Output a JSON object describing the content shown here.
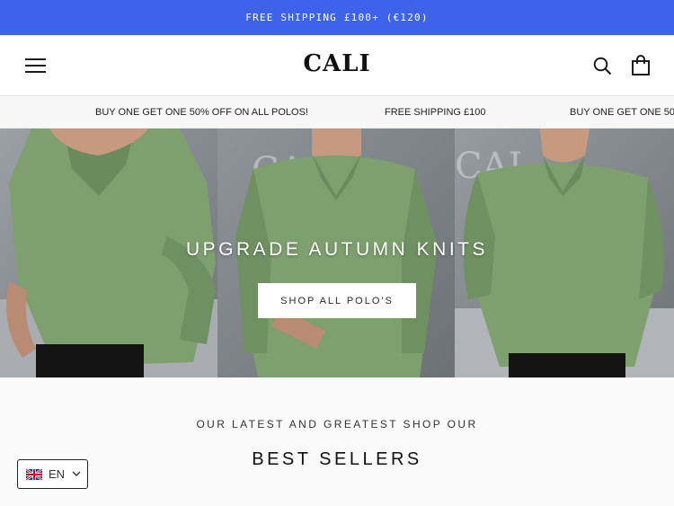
{
  "announcement": {
    "text": "FREE SHIPPING £100+ (€120)"
  },
  "header": {
    "logo": "CALI",
    "icons": [
      "menu-icon",
      "search-icon",
      "shopping-bag-icon"
    ]
  },
  "marquee": {
    "items": [
      "BUY ONE GET ONE 50% OFF ON ALL POLOS!",
      "FREE SHIPPING £100",
      "BUY ONE GET ONE 50%"
    ]
  },
  "hero": {
    "title": "UPGRADE AUTUMN KNITS",
    "button_label": "SHOP ALL POLO'S",
    "colors": {
      "shirt": "#7a9e6c",
      "wall": "#8d9196"
    }
  },
  "section": {
    "subtitle": "OUR LATEST AND GREATEST SHOP OUR",
    "title": "BEST SELLERS"
  },
  "language": {
    "code": "EN",
    "flag_icon": "uk-flag-icon"
  },
  "colors": {
    "accent": "#3d63ea"
  }
}
